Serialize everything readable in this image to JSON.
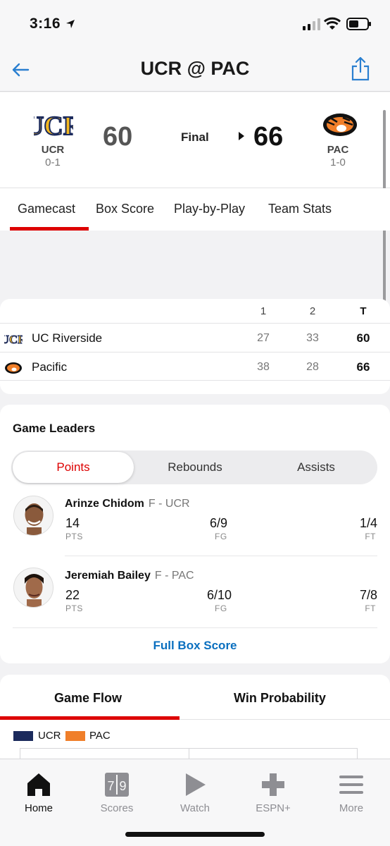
{
  "status_bar": {
    "time": "3:16"
  },
  "nav": {
    "title": "UCR @ PAC"
  },
  "scoreboard": {
    "away": {
      "abbr": "UCR",
      "record": "0-1",
      "score": "60"
    },
    "home": {
      "abbr": "PAC",
      "record": "1-0",
      "score": "66"
    },
    "status": "Final"
  },
  "tabs": [
    "Gamecast",
    "Box Score",
    "Play-by-Play",
    "Team Stats"
  ],
  "linescore": {
    "headers": [
      "1",
      "2",
      "T"
    ],
    "rows": [
      {
        "team": "UC Riverside",
        "periods": [
          "27",
          "33"
        ],
        "total": "60"
      },
      {
        "team": "Pacific",
        "periods": [
          "38",
          "28"
        ],
        "total": "66"
      }
    ]
  },
  "leaders": {
    "title": "Game Leaders",
    "segments": [
      "Points",
      "Rebounds",
      "Assists"
    ],
    "players": [
      {
        "name": "Arinze Chidom",
        "pos": "F - UCR",
        "stats": [
          [
            "14",
            "PTS"
          ],
          [
            "6/9",
            "FG"
          ],
          [
            "1/4",
            "FT"
          ]
        ]
      },
      {
        "name": "Jeremiah Bailey",
        "pos": "F - PAC",
        "stats": [
          [
            "22",
            "PTS"
          ],
          [
            "6/10",
            "FG"
          ],
          [
            "7/8",
            "FT"
          ]
        ]
      }
    ],
    "link": "Full Box Score"
  },
  "flow": {
    "tabs": [
      "Game Flow",
      "Win Probability"
    ],
    "legend": [
      {
        "label": "UCR",
        "color": "#1b2a5c"
      },
      {
        "label": "PAC",
        "color": "#f07f2a"
      }
    ]
  },
  "tab_bar": [
    "Home",
    "Scores",
    "Watch",
    "ESPN+",
    "More"
  ],
  "colors": {
    "accent_red": "#dd0000",
    "link_blue": "#0a6fbf"
  }
}
